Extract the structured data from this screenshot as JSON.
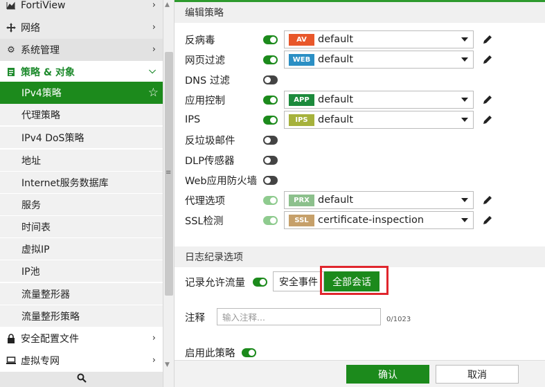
{
  "sidebar": {
    "items": [
      {
        "label": "FortiView"
      },
      {
        "label": "网络"
      },
      {
        "label": "系统管理"
      },
      {
        "label": "策略 & 对象"
      },
      {
        "label": "IPv4策略"
      },
      {
        "label": "代理策略"
      },
      {
        "label": "IPv4 DoS策略"
      },
      {
        "label": "地址"
      },
      {
        "label": "Internet服务数据库"
      },
      {
        "label": "服务"
      },
      {
        "label": "时间表"
      },
      {
        "label": "虚拟IP"
      },
      {
        "label": "IP池"
      },
      {
        "label": "流量整形器"
      },
      {
        "label": "流量整形策略"
      },
      {
        "label": "安全配置文件"
      },
      {
        "label": "虚拟专网"
      }
    ]
  },
  "main": {
    "edit_header": "编辑策略",
    "profiles": [
      {
        "label": "反病毒",
        "enabled": true,
        "badge": "AV",
        "badge_color": "#e8572a",
        "value": "default"
      },
      {
        "label": "网页过滤",
        "enabled": true,
        "badge": "WEB",
        "badge_color": "#2b8fc4",
        "value": "default"
      },
      {
        "label": "DNS 过滤",
        "enabled": false
      },
      {
        "label": "应用控制",
        "enabled": true,
        "badge": "APP",
        "badge_color": "#1c8a3c",
        "value": "default"
      },
      {
        "label": "IPS",
        "enabled": true,
        "badge": "IPS",
        "badge_color": "#a6b23c",
        "value": "default"
      },
      {
        "label": "反垃圾邮件",
        "enabled": false
      },
      {
        "label": "DLP传感器",
        "enabled": false
      },
      {
        "label": "Web应用防火墙",
        "enabled": false
      },
      {
        "label": "代理选项",
        "enabled": true,
        "badge": "PRX",
        "badge_color": "#8cc08c",
        "value": "default"
      },
      {
        "label": "SSL检测",
        "enabled": true,
        "badge": "SSL",
        "badge_color": "#c6a06a",
        "value": "certificate-inspection"
      }
    ],
    "log_header": "日志纪录选项",
    "log_allowed_label": "记录允许流量",
    "log_option_security": "安全事件",
    "log_option_all": "全部会话",
    "comment_label": "注释",
    "comment_placeholder": "输入注释...",
    "comment_counter": "0/1023",
    "enable_policy_label": "启用此策略",
    "ok_button": "确认",
    "cancel_button": "取消"
  },
  "colors": {
    "accent_green": "#1c8a1c",
    "highlight_red": "#e0262d"
  }
}
